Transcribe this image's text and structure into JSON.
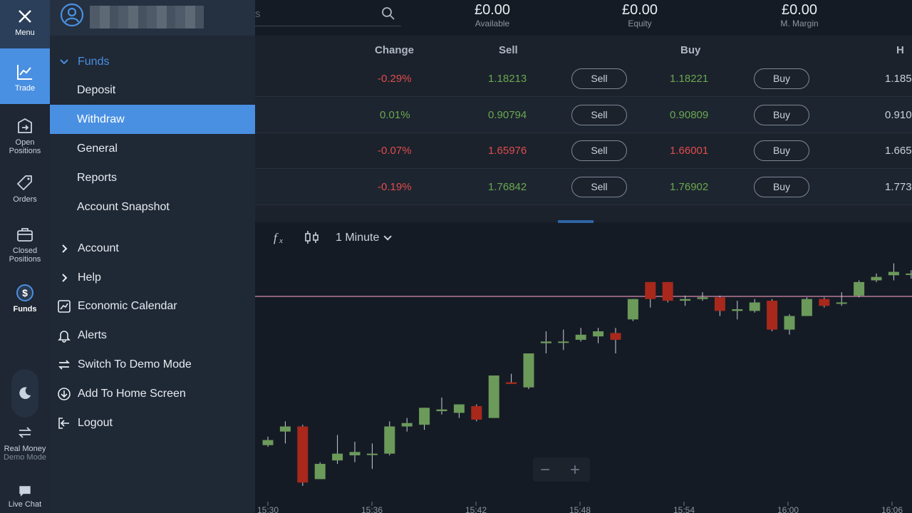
{
  "rail": {
    "menu": "Menu",
    "trade": "Trade",
    "open_positions": "Open Positions",
    "orders": "Orders",
    "closed_positions": "Closed Positions",
    "funds": "Funds",
    "real_money": "Real Money",
    "demo_mode": "Demo Mode",
    "live_chat": "Live Chat"
  },
  "menu": {
    "funds": "Funds",
    "deposit": "Deposit",
    "withdraw": "Withdraw",
    "general": "General",
    "reports": "Reports",
    "account_snapshot": "Account Snapshot",
    "account": "Account",
    "help": "Help",
    "economic_calendar": "Economic Calendar",
    "alerts": "Alerts",
    "switch_demo": "Switch To Demo Mode",
    "add_home": "Add To Home Screen",
    "logout": "Logout"
  },
  "header": {
    "search_placeholder": "s",
    "available_value": "£0.00",
    "available_label": "Available",
    "equity_value": "£0.00",
    "equity_label": "Equity",
    "margin_value": "£0.00",
    "margin_label": "M. Margin"
  },
  "table": {
    "col_change": "Change",
    "col_sell": "Sell",
    "col_buy": "Buy",
    "col_high": "H",
    "sell_label": "Sell",
    "buy_label": "Buy",
    "rows": [
      {
        "change": "-0.29%",
        "sell": "1.18213",
        "buy": "1.18221",
        "high": "1.185"
      },
      {
        "change": "0.01%",
        "sell": "0.90794",
        "buy": "0.90809",
        "high": "0.910"
      },
      {
        "change": "-0.07%",
        "sell": "1.65976",
        "buy": "1.66001",
        "high": "1.665"
      },
      {
        "change": "-0.19%",
        "sell": "1.76842",
        "buy": "1.76902",
        "high": "1.773"
      }
    ]
  },
  "chart": {
    "timeframe": "1 Minute",
    "zoom_out": "−",
    "zoom_in": "+",
    "colors": {
      "up": "#6b9a5a",
      "down": "#a8281c",
      "line": "#b87a9a"
    }
  },
  "chart_data": {
    "type": "candlestick",
    "x_ticks": [
      "15:30",
      "15:36",
      "15:42",
      "15:48",
      "15:54",
      "16:00",
      "16:06"
    ],
    "ylim": [
      0,
      100
    ],
    "reference_line": 74.5,
    "candles": [
      {
        "o": 24,
        "c": 27,
        "h": 29,
        "l": 23
      },
      {
        "o": 32,
        "c": 35,
        "h": 38,
        "l": 25
      },
      {
        "o": 35,
        "c": 2,
        "h": 36,
        "l": 0
      },
      {
        "o": 4,
        "c": 13,
        "h": 14,
        "l": 4
      },
      {
        "o": 15,
        "c": 19,
        "h": 30,
        "l": 13
      },
      {
        "o": 18,
        "c": 20,
        "h": 26,
        "l": 14
      },
      {
        "o": 19,
        "c": 19,
        "h": 25,
        "l": 10
      },
      {
        "o": 19,
        "c": 35,
        "h": 38,
        "l": 18
      },
      {
        "o": 35,
        "c": 37,
        "h": 40,
        "l": 32
      },
      {
        "o": 36,
        "c": 46,
        "h": 46,
        "l": 33
      },
      {
        "o": 44,
        "c": 45,
        "h": 52,
        "l": 42
      },
      {
        "o": 43,
        "c": 48,
        "h": 48,
        "l": 40
      },
      {
        "o": 47,
        "c": 39,
        "h": 48,
        "l": 38
      },
      {
        "o": 40,
        "c": 65,
        "h": 65,
        "l": 40
      },
      {
        "o": 61,
        "c": 60,
        "h": 66,
        "l": 60
      },
      {
        "o": 58,
        "c": 78,
        "h": 78,
        "l": 57
      },
      {
        "o": 84,
        "c": 85,
        "h": 91,
        "l": 78
      },
      {
        "o": 85,
        "c": 85,
        "h": 92,
        "l": 80
      },
      {
        "o": 86,
        "c": 89,
        "h": 93,
        "l": 85
      },
      {
        "o": 88,
        "c": 91,
        "h": 93,
        "l": 84
      },
      {
        "o": 90,
        "c": 86,
        "h": 93,
        "l": 78
      },
      {
        "o": 98,
        "c": 110,
        "h": 110,
        "l": 97
      },
      {
        "o": 120,
        "c": 110,
        "h": 120,
        "l": 105
      },
      {
        "o": 120,
        "c": 109,
        "h": 120,
        "l": 108
      },
      {
        "o": 109,
        "c": 110,
        "h": 112,
        "l": 106
      },
      {
        "o": 110,
        "c": 111,
        "h": 114,
        "l": 109
      },
      {
        "o": 111,
        "c": 103,
        "h": 112,
        "l": 100
      },
      {
        "o": 103,
        "c": 104,
        "h": 109,
        "l": 98
      },
      {
        "o": 103,
        "c": 108,
        "h": 110,
        "l": 102
      },
      {
        "o": 109,
        "c": 92,
        "h": 110,
        "l": 91
      },
      {
        "o": 92,
        "c": 100,
        "h": 101,
        "l": 89
      },
      {
        "o": 100,
        "c": 110,
        "h": 111,
        "l": 100
      },
      {
        "o": 110,
        "c": 106,
        "h": 111,
        "l": 105
      },
      {
        "o": 108,
        "c": 108,
        "h": 114,
        "l": 106
      },
      {
        "o": 112,
        "c": 120,
        "h": 121,
        "l": 111
      },
      {
        "o": 121,
        "c": 123,
        "h": 125,
        "l": 120
      },
      {
        "o": 124,
        "c": 126,
        "h": 131,
        "l": 121
      },
      {
        "o": 125,
        "c": 125,
        "h": 127,
        "l": 122
      }
    ]
  }
}
